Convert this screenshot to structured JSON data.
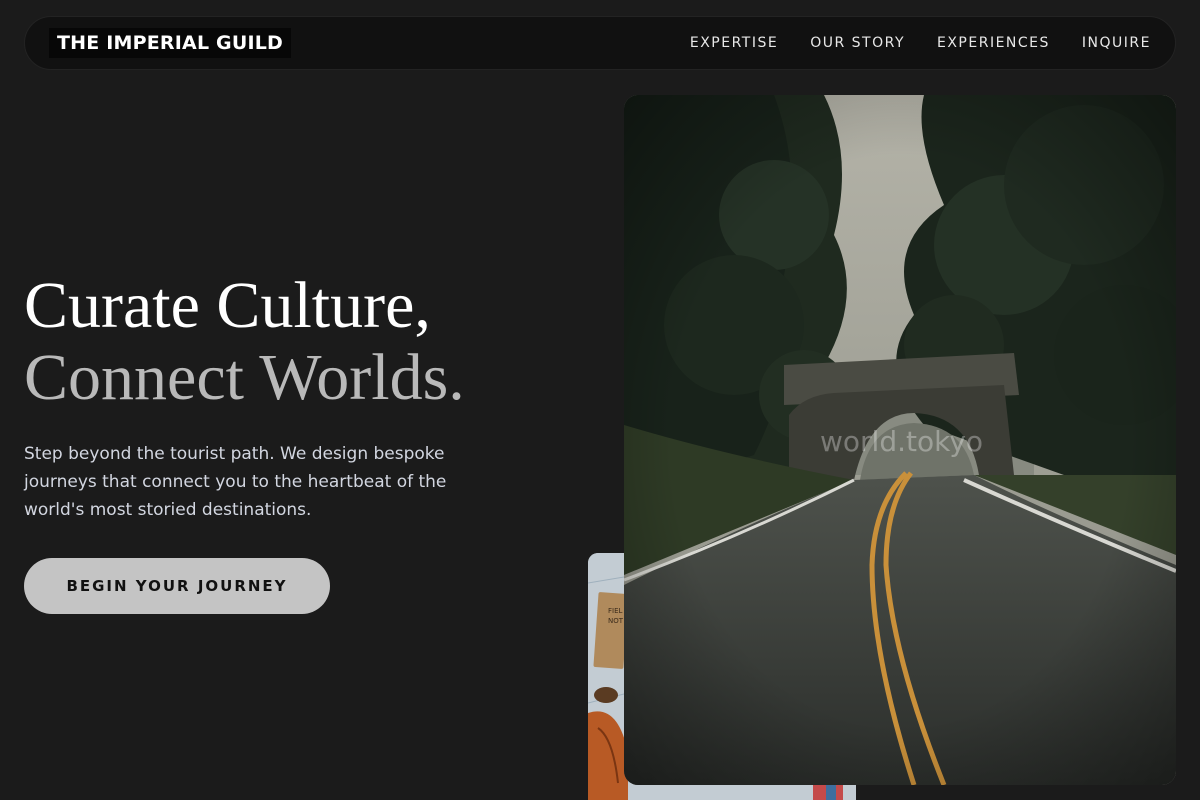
{
  "nav": {
    "brand": "THE IMPERIAL GUILD",
    "links": [
      "EXPERTISE",
      "OUR STORY",
      "EXPERIENCES",
      "INQUIRE"
    ]
  },
  "hero": {
    "headline_line1": "Curate Culture,",
    "headline_line2": "Connect Worlds.",
    "subtitle": "Step beyond the tourist path. We design bespoke journeys that connect you to the heartbeat of the world's most storied destinations.",
    "cta_label": "BEGIN YOUR JOURNEY"
  },
  "media": {
    "main_image_watermark": "world.tokyo",
    "small_image_note": "FIELD NOTES"
  },
  "colors": {
    "background": "#1b1b1b",
    "nav_background": "#111111",
    "cta_background": "#c4c4c4",
    "headline_secondary": "#b9b9b9"
  }
}
